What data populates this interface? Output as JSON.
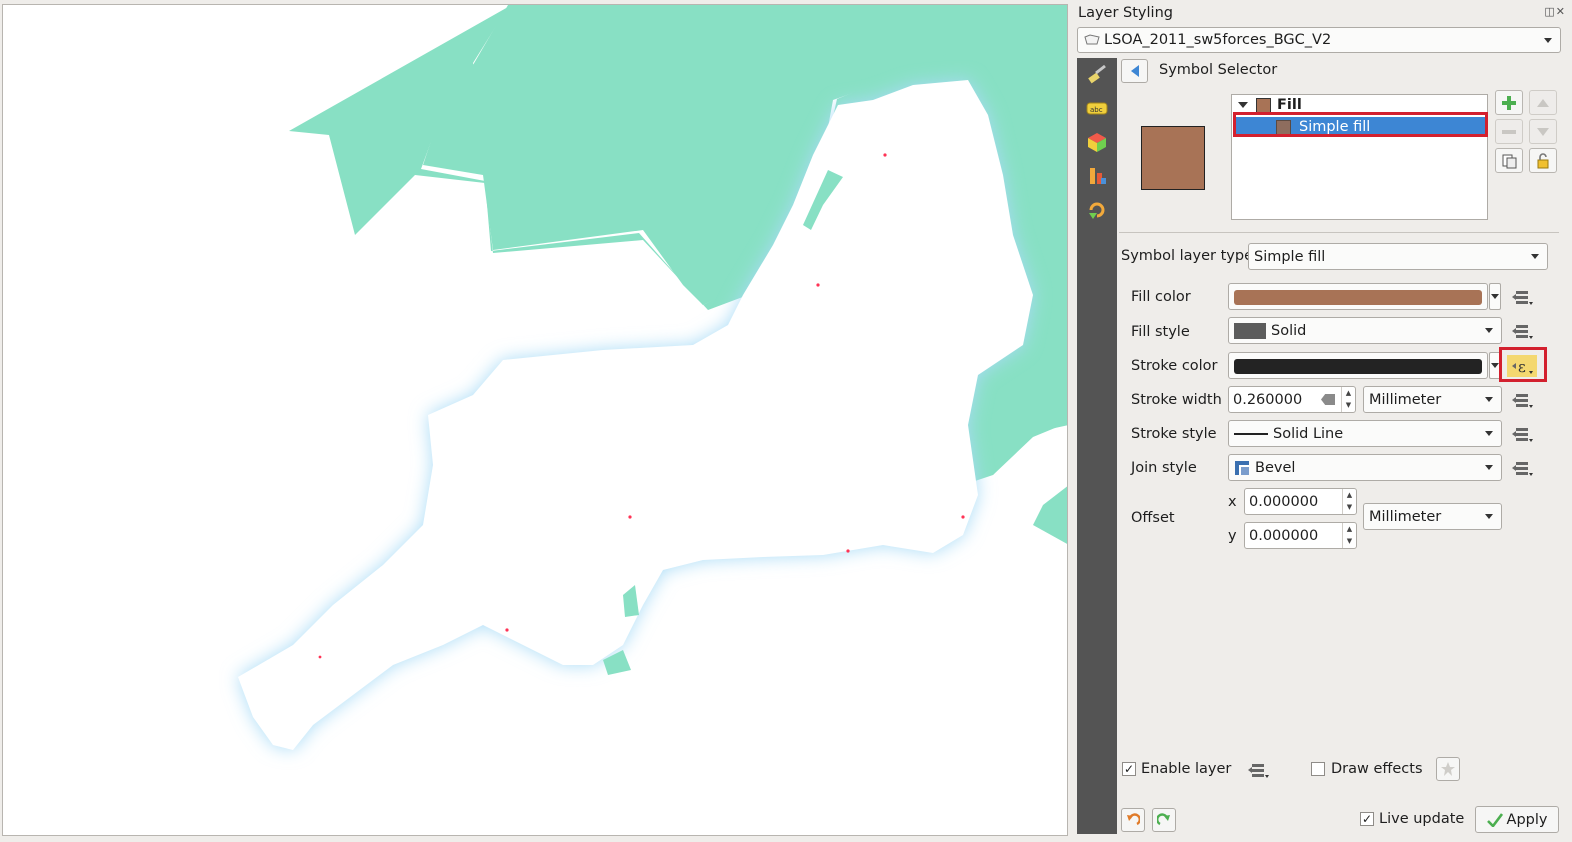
{
  "panel": {
    "title": "Layer Styling",
    "dock_buttons": "◫✕",
    "layer_name": "LSOA_2011_sw5forces_BGC_V2",
    "selector_title": "Symbol Selector"
  },
  "symbol_tree": {
    "root_label": "Fill",
    "child_label": "Simple fill"
  },
  "properties": {
    "symbol_layer_type_label": "Symbol layer type",
    "symbol_layer_type_value": "Simple fill",
    "fill_color_label": "Fill color",
    "fill_color": "#a87356",
    "fill_style_label": "Fill style",
    "fill_style_value": "Solid",
    "stroke_color_label": "Stroke color",
    "stroke_color": "#232323",
    "stroke_width_label": "Stroke width",
    "stroke_width_value": "0.260000",
    "stroke_width_unit": "Millimeter",
    "stroke_style_label": "Stroke style",
    "stroke_style_value": "Solid Line",
    "join_style_label": "Join style",
    "join_style_value": "Bevel",
    "offset_label": "Offset",
    "offset_x_label": "x",
    "offset_x_value": "0.000000",
    "offset_y_label": "y",
    "offset_y_value": "0.000000",
    "offset_unit": "Millimeter"
  },
  "footer": {
    "enable_layer_label": "Enable layer",
    "enable_layer_checked": "✓",
    "draw_effects_label": "Draw effects",
    "live_update_label": "Live update",
    "live_update_checked": "✓",
    "apply_label": "Apply"
  },
  "colors": {
    "sea": "#88e0c4",
    "land": "#ffffff",
    "highlight": "#d3202e",
    "selection": "#3d86d4"
  }
}
